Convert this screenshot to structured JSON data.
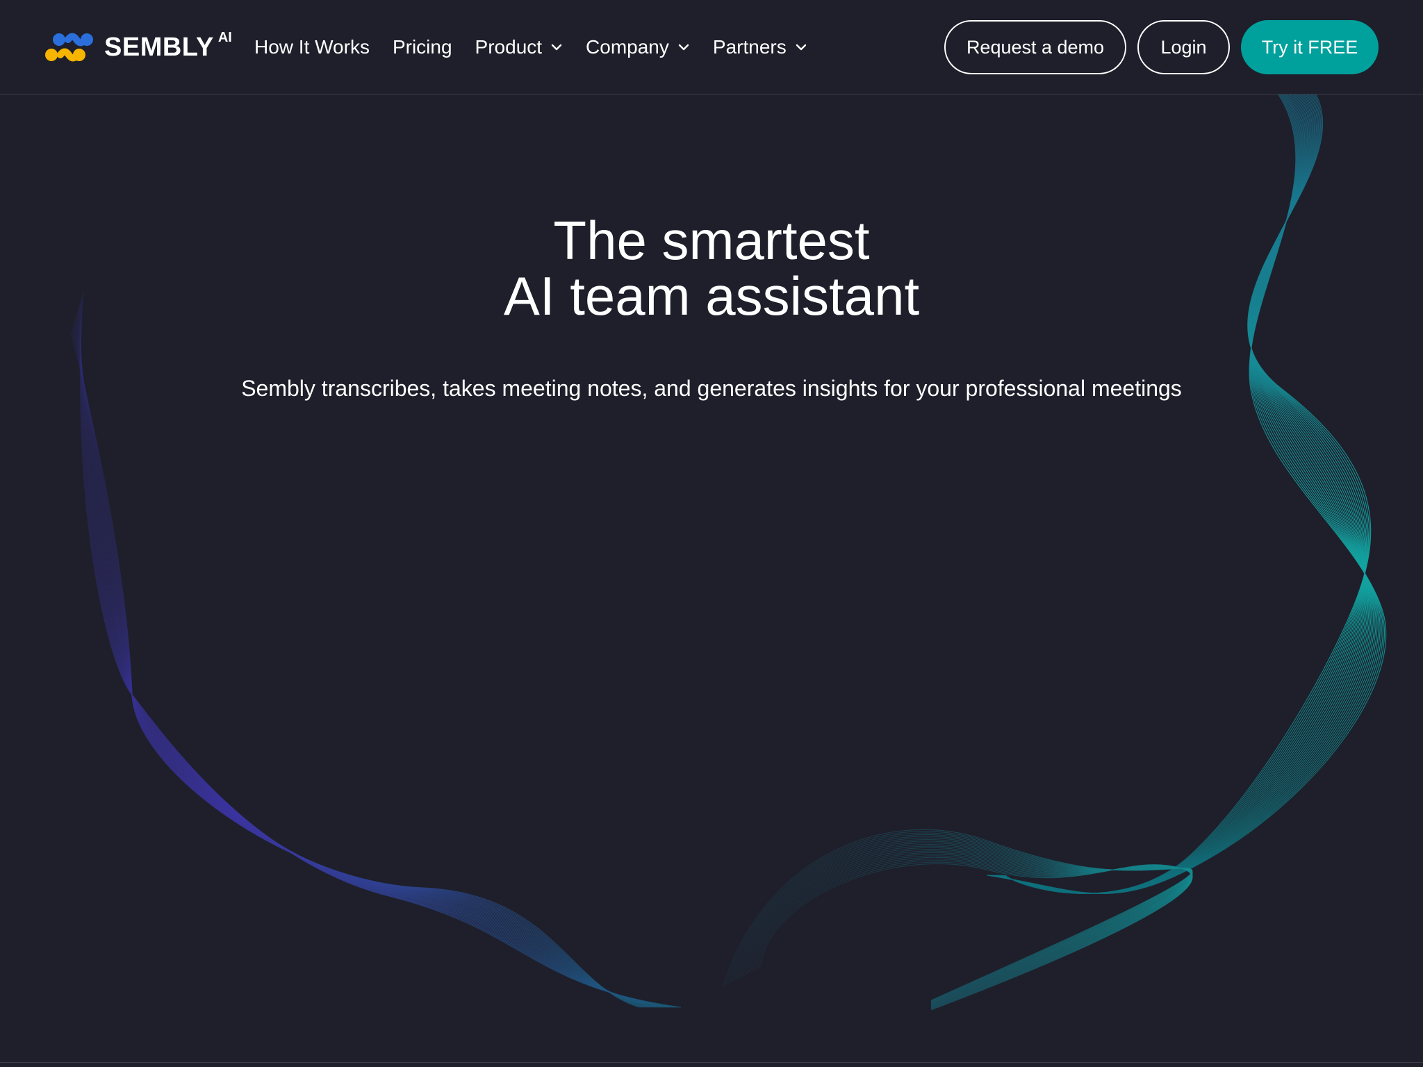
{
  "brand": {
    "name": "SEMBLY",
    "suffix": "AI",
    "logo_icon": "sembly-dots-logo",
    "colors": {
      "logo_blue": "#2a6fdb",
      "logo_yellow": "#f7b500",
      "accent_teal": "#00a19c",
      "background": "#1e1f2a",
      "wave_left": "#3a2f8f",
      "wave_right": "#0f8f95"
    }
  },
  "nav": {
    "items": [
      {
        "label": "How It Works",
        "has_dropdown": false
      },
      {
        "label": "Pricing",
        "has_dropdown": false
      },
      {
        "label": "Product",
        "has_dropdown": true
      },
      {
        "label": "Company",
        "has_dropdown": true
      },
      {
        "label": "Partners",
        "has_dropdown": true
      }
    ],
    "dropdown_icon": "chevron-down-icon"
  },
  "actions": {
    "demo_label": "Request a demo",
    "login_label": "Login",
    "free_label": "Try it FREE"
  },
  "hero": {
    "title_line1": "The smartest",
    "title_line2": "AI team assistant",
    "subtitle": "Sembly transcribes, takes meeting notes, and generates insights for your professional meetings"
  }
}
